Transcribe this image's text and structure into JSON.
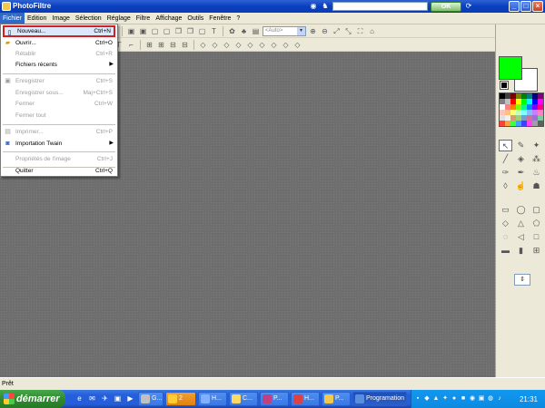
{
  "window": {
    "title": "PhotoFiltre",
    "ok_label": "OK"
  },
  "menubar": {
    "items": [
      "Fichier",
      "Edition",
      "Image",
      "Sélection",
      "Réglage",
      "Filtre",
      "Affichage",
      "Outils",
      "Fenêtre",
      "?"
    ]
  },
  "toolbar": {
    "zoom_value": "<Auto>"
  },
  "file_menu": {
    "items": [
      {
        "label": "Nouveau...",
        "shortcut": "Ctrl+N",
        "enabled": true,
        "highlighted": true
      },
      {
        "label": "Ouvrir...",
        "shortcut": "Ctrl+O",
        "enabled": true
      },
      {
        "label": "Rétablir",
        "shortcut": "Ctrl+R",
        "enabled": false
      },
      {
        "label": "Fichiers récents",
        "shortcut": "",
        "enabled": true,
        "submenu": true
      },
      {
        "label": "Enregistrer",
        "shortcut": "Ctrl+S",
        "enabled": false
      },
      {
        "label": "Enregistrer sous...",
        "shortcut": "Maj+Ctrl+S",
        "enabled": false
      },
      {
        "label": "Fermer",
        "shortcut": "Ctrl+W",
        "enabled": false
      },
      {
        "label": "Fermer tout",
        "shortcut": "",
        "enabled": false
      },
      {
        "label": "Imprimer...",
        "shortcut": "Ctrl+P",
        "enabled": false
      },
      {
        "label": "Importation Twain",
        "shortcut": "",
        "enabled": true,
        "submenu": true
      },
      {
        "label": "Propriétés de l'image",
        "shortcut": "Ctrl+J",
        "enabled": false
      },
      {
        "label": "Quitter",
        "shortcut": "Ctrl+Q",
        "enabled": true
      }
    ]
  },
  "colors": {
    "foreground": "#00ff00",
    "background": "#ffffff",
    "highlight_border": "#d51f1f"
  },
  "status": {
    "text": "Prêt"
  },
  "taskbar": {
    "start_label": "démarrer",
    "tasks": [
      {
        "label": "G..."
      },
      {
        "label": "2"
      },
      {
        "label": "H..."
      },
      {
        "label": "C..."
      },
      {
        "label": "P..."
      },
      {
        "label": "H..."
      },
      {
        "label": "P..."
      },
      {
        "label": "Programation"
      }
    ],
    "clock": "21:31"
  }
}
